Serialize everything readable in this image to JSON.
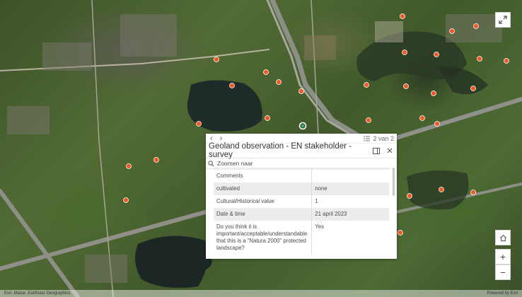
{
  "popup": {
    "nav_prev": "‹",
    "nav_next": "›",
    "pager_text": "2 van 2",
    "title": "Geoland observation - EN stakeholder - survey",
    "dock_icon": "dock-icon",
    "close_icon": "close-icon",
    "zoom_label": "Zoomen naar",
    "rows": [
      {
        "key": "Comments",
        "value": ""
      },
      {
        "key": "cultivated",
        "value": "none"
      },
      {
        "key": "Cultural/Historical value",
        "value": "1"
      },
      {
        "key": "Date & time",
        "value": "21 april 2023"
      },
      {
        "key": "Do you think it is important/acceptable/understandable that this is a \"Natura 2000\" protected landscape?",
        "value": "Yes"
      }
    ]
  },
  "controls": {
    "fullscreen_icon": "expand-icon",
    "home_icon": "home-icon",
    "zoom_in": "+",
    "zoom_out": "−"
  },
  "attribution": {
    "left": "Esri, Maxar, Earthstar Geographics",
    "right": "Powered by Esri"
  },
  "colors": {
    "marker_fill": "#f15a24",
    "marker_stroke": "#ffffff",
    "selected_marker": "#37b29f"
  }
}
